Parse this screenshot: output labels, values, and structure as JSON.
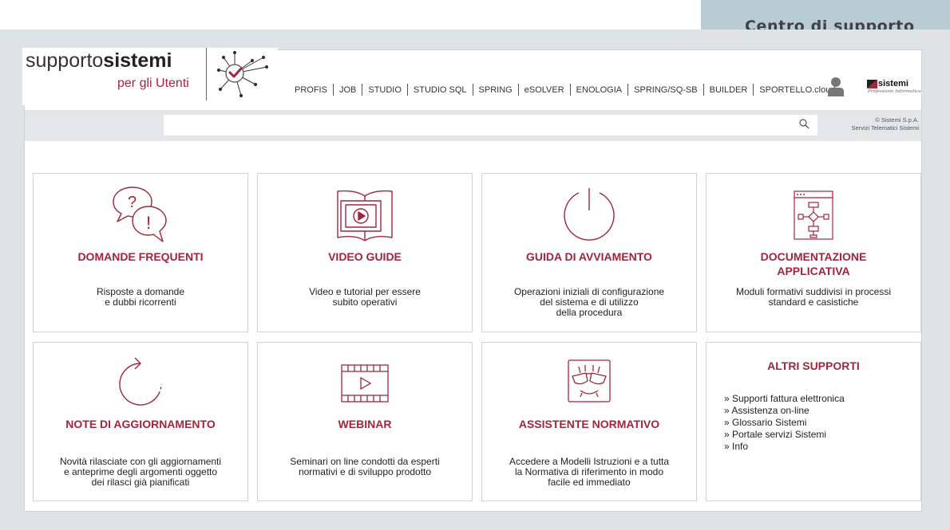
{
  "header": {
    "tab_title": "Centro di supporto",
    "logo": {
      "prefix": "supporto",
      "bold": "sistemi",
      "subtitle": "per gli Utenti"
    },
    "nav": [
      "PROFIS",
      "JOB",
      "STUDIO",
      "STUDIO SQL",
      "SPRING",
      "eSOLVER",
      "ENOLOGIA",
      "SPRING/SQ-SB",
      "BUILDER",
      "SPORTELLO.cloud"
    ],
    "brand": {
      "name": "sistemi",
      "tagline": "Professione Informatica"
    }
  },
  "search": {
    "placeholder": "",
    "copyright_line1": "© Sistemi S.p.A.",
    "copyright_line2": "Servizi Telematici Sistemi"
  },
  "cards": [
    {
      "title": "DOMANDE FREQUENTI",
      "desc": [
        "Risposte a domande",
        "e dubbi ricorrenti"
      ],
      "icon": "faq-bubbles-icon"
    },
    {
      "title": "VIDEO GUIDE",
      "desc": [
        "Video e tutorial per essere",
        "subito operativi"
      ],
      "icon": "video-book-icon"
    },
    {
      "title": "GUIDA DI AVVIAMENTO",
      "desc": [
        "Operazioni iniziali di configurazione",
        "del sistema e di utilizzo",
        "della procedura"
      ],
      "icon": "power-icon"
    },
    {
      "title": [
        "DOCUMENTAZIONE",
        "APPLICATIVA"
      ],
      "desc": [
        "Moduli formativi suddivisi in processi",
        "standard e casistiche"
      ],
      "icon": "flowchart-window-icon"
    },
    {
      "title": "NOTE DI AGGIORNAMENTO",
      "desc": [
        "Novità rilasciate con gli aggiornamenti",
        "e anteprime degli argomenti oggetto",
        "dei rilasci già pianificati"
      ],
      "icon": "refresh-arrow-icon"
    },
    {
      "title": "WEBINAR",
      "desc": [
        "Seminari on line condotti da esperti",
        "normativi e di sviluppo prodotto"
      ],
      "icon": "film-play-icon"
    },
    {
      "title": "ASSISTENTE NORMATIVO",
      "desc": [
        "Accedere a Modelli Istruzioni e a tutta",
        "la Normativa di riferimento in modo",
        "facile ed immediato"
      ],
      "icon": "glasses-assistant-icon"
    },
    {
      "title": "ALTRI SUPPORTI",
      "links": [
        "» Supporti fattura elettronica",
        "» Assistenza on-line",
        "» Glossario Sistemi",
        "» Portale servizi Sistemi",
        "» Info"
      ]
    }
  ],
  "colors": {
    "accent": "#a0253d",
    "frame": "#dfe3e6",
    "tab": "#b9cbd3",
    "search_band": "#e5e6e7"
  }
}
